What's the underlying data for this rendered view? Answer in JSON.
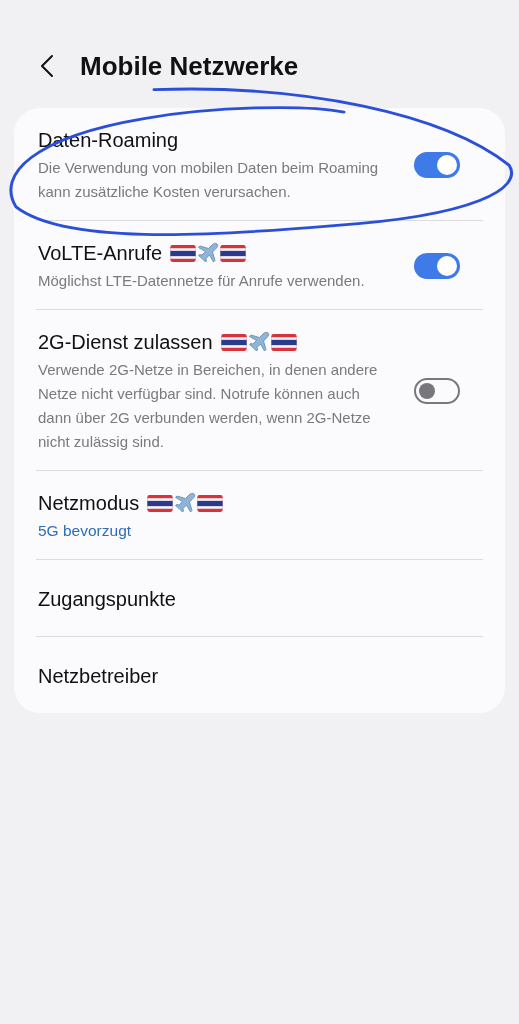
{
  "header": {
    "title": "Mobile Netzwerke"
  },
  "settings": [
    {
      "kind": "toggle",
      "title": "Daten-Roaming",
      "description": "Die Verwendung von mobilen Daten beim Roaming kann zusätzliche Kosten verursachen.",
      "on": true,
      "flags": false,
      "circled": true
    },
    {
      "kind": "toggle",
      "title": "VoLTE-Anrufe",
      "description": "Möglichst LTE-Datennetze für Anrufe verwenden.",
      "on": true,
      "flags": true,
      "circled": false
    },
    {
      "kind": "toggle",
      "title": "2G-Dienst zulassen",
      "description": "Verwende 2G-Netze in Bereichen, in denen andere Netze nicht verfügbar sind. Notrufe können auch dann über 2G verbunden werden, wenn 2G-Netze nicht zulässig sind.",
      "on": false,
      "flags": true,
      "circled": false
    },
    {
      "kind": "link",
      "title": "Netzmodus",
      "value": "5G bevorzugt",
      "flags": true,
      "circled": false
    },
    {
      "kind": "link",
      "title": "Zugangspunkte",
      "flags": false,
      "circled": false
    },
    {
      "kind": "link",
      "title": "Netzbetreiber",
      "flags": false,
      "circled": false
    }
  ]
}
